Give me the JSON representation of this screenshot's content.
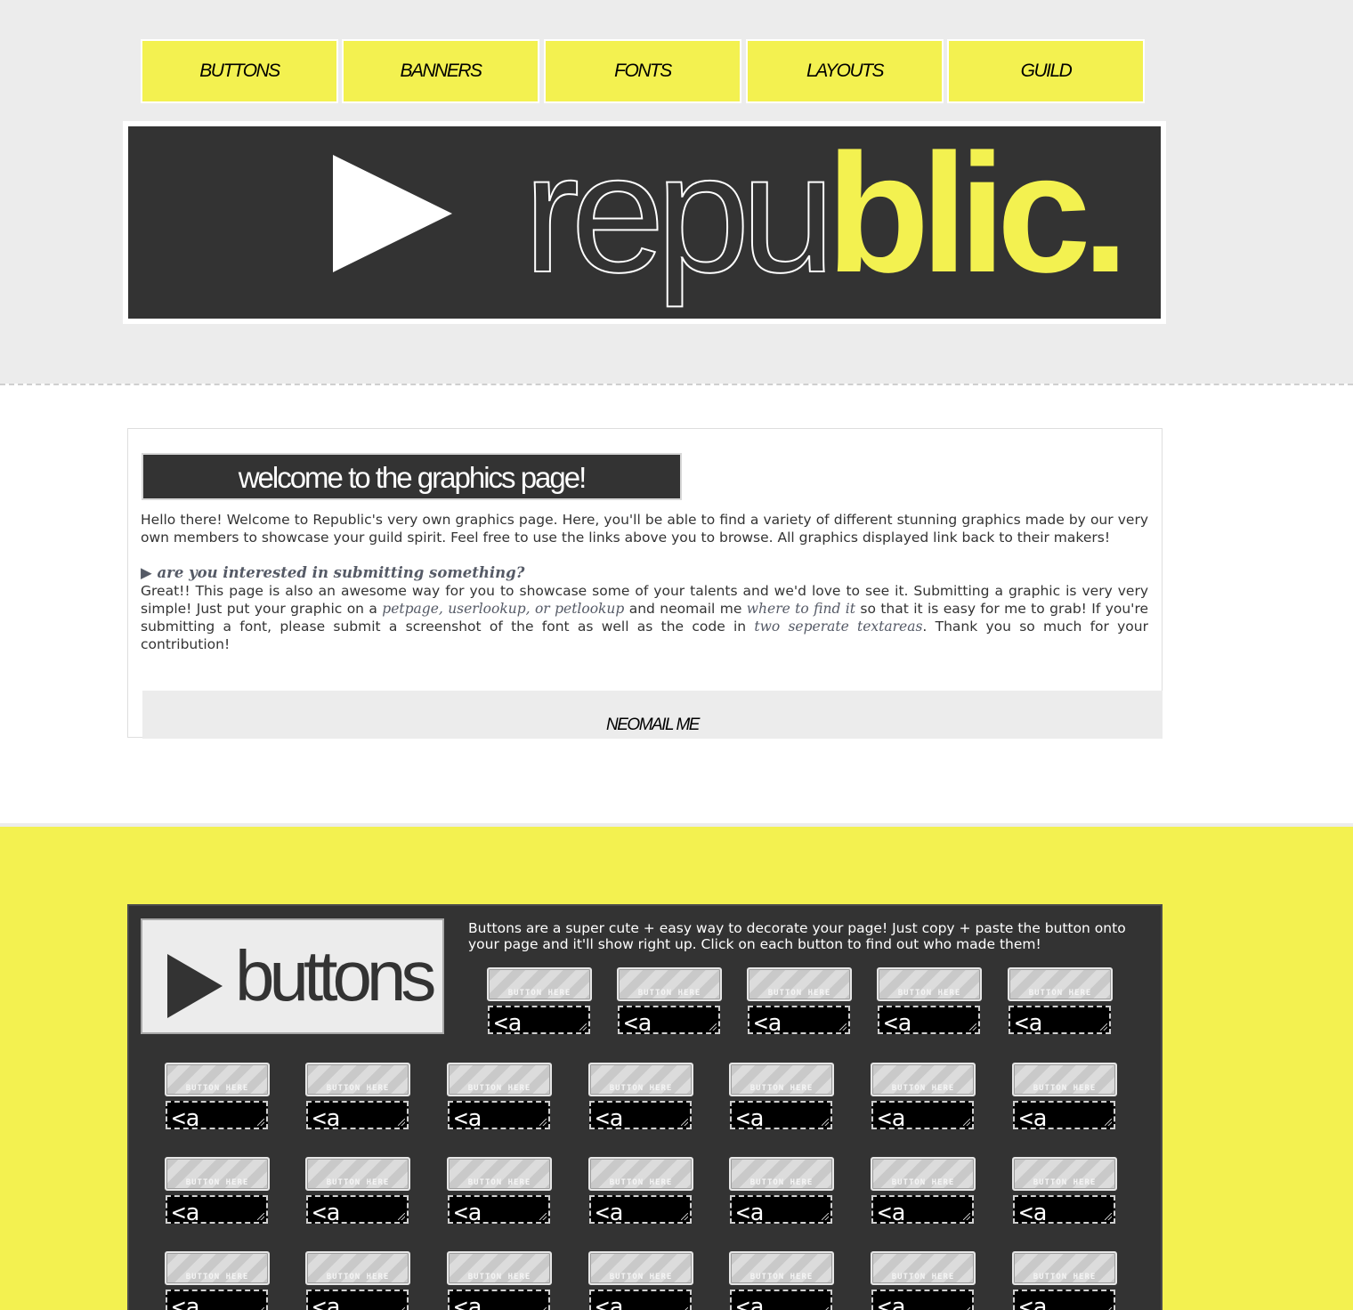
{
  "nav": {
    "items": [
      {
        "label": "BUTTONS"
      },
      {
        "label": "BANNERS"
      },
      {
        "label": "FONTS"
      },
      {
        "label": "LAYOUTS"
      },
      {
        "label": "GUILD"
      }
    ]
  },
  "header": {
    "logo_light": "repu",
    "logo_bold": "blic."
  },
  "welcome": {
    "title": "welcome to the graphics page!",
    "intro": "Hello there! Welcome to Republic's very own graphics page. Here, you'll be able to find a variety of different stunning graphics made by our very own members to showcase your guild spirit. Feel free to use the links above you to browse. All graphics displayed link back to their makers!",
    "subhead_arrow": "▶",
    "subhead": "are you interested in submitting something?",
    "submit_part1": "Great!! This page is also an awesome way for you to showcase some of your talents and we'd love to see it. Submitting a graphic is very very simple! Just put your graphic on a ",
    "submit_em1": "petpage, userlookup, or petlookup",
    "submit_part2": " and neomail me ",
    "submit_em2": "where to find it",
    "submit_part3": " so that it is easy for me to grab! If you're submitting a font, please submit a screenshot of the font as well as the code in ",
    "submit_em3": "two seperate textareas",
    "submit_part4": ". Thank you so much for your contribution!",
    "neomail_label": "NEOMAIL ME"
  },
  "buttons_section": {
    "title": "buttons",
    "description": "Buttons are a super cute + easy way to decorate your page! Just copy + paste the button onto your page and it'll show right up. Click on each button to find out who made them!",
    "button_image_text": "BUTTON HERE",
    "code_snippet": "<a"
  },
  "colors": {
    "accent_yellow": "#f3f150",
    "dark": "#333333",
    "light_grey": "#ececec"
  }
}
